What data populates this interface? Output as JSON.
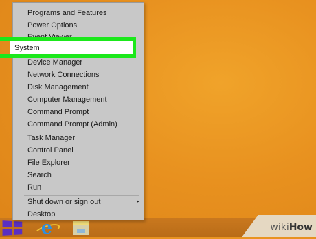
{
  "menu": {
    "items": [
      {
        "label": "Programs and Features"
      },
      {
        "label": "Power Options"
      },
      {
        "label": "Event Viewer"
      },
      {
        "label": "System"
      },
      {
        "label": "Device Manager"
      },
      {
        "label": "Network Connections"
      },
      {
        "label": "Disk Management"
      },
      {
        "label": "Computer Management"
      },
      {
        "label": "Command Prompt"
      },
      {
        "label": "Command Prompt (Admin)"
      },
      {
        "label": "Task Manager"
      },
      {
        "label": "Control Panel"
      },
      {
        "label": "File Explorer"
      },
      {
        "label": "Search"
      },
      {
        "label": "Run"
      },
      {
        "label": "Shut down or sign out"
      },
      {
        "label": "Desktop"
      }
    ],
    "highlighted_item": "System",
    "submenu_arrow": "▸"
  },
  "colors": {
    "desktop": "#e8911f",
    "highlight_border": "#1be81b",
    "menu_background": "#c8c8c8"
  },
  "taskbar": {
    "icons": [
      "windows-start-icon",
      "internet-explorer-icon",
      "file-explorer-icon"
    ],
    "ie_glyph": "e"
  },
  "watermark": {
    "prefix": "wiki",
    "suffix": "How"
  }
}
